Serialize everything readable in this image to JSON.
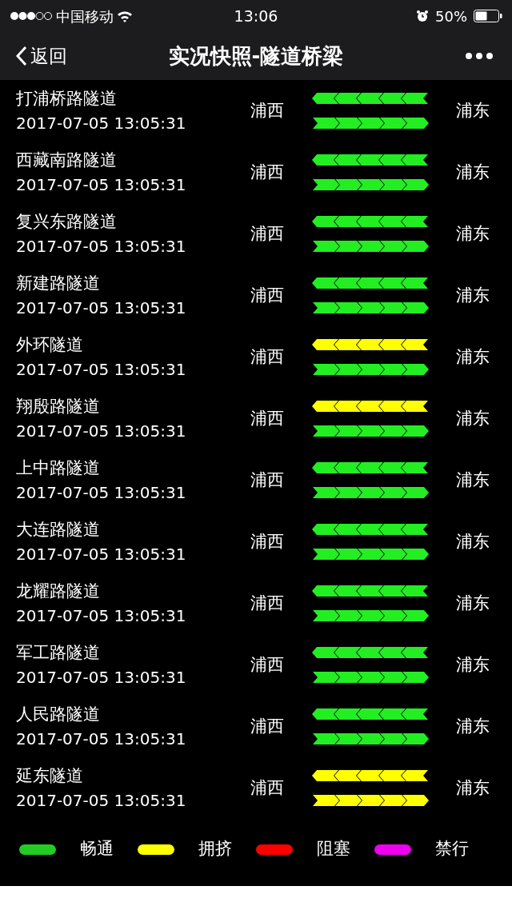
{
  "status_bar": {
    "carrier": "中国移动",
    "time": "13:06",
    "battery": "50%"
  },
  "nav": {
    "back": "返回",
    "title": "实况快照-隧道桥梁"
  },
  "tunnels": [
    {
      "name": "打浦桥路隧道",
      "time": "2017-07-05 13:05:31",
      "west": "浦西",
      "east": "浦东",
      "lanes": [
        {
          "kind": "westbound",
          "color": "#22ee22"
        },
        {
          "kind": "eastbound",
          "color": "#22ee22"
        }
      ]
    },
    {
      "name": "西藏南路隧道",
      "time": "2017-07-05 13:05:31",
      "west": "浦西",
      "east": "浦东",
      "lanes": [
        {
          "kind": "westbound",
          "color": "#22ee22"
        },
        {
          "kind": "eastbound",
          "color": "#22ee22"
        }
      ]
    },
    {
      "name": "复兴东路隧道",
      "time": "2017-07-05 13:05:31",
      "west": "浦西",
      "east": "浦东",
      "lanes": [
        {
          "kind": "westbound",
          "color": "#22ee22"
        },
        {
          "kind": "eastbound",
          "color": "#22ee22"
        }
      ]
    },
    {
      "name": "新建路隧道",
      "time": "2017-07-05 13:05:31",
      "west": "浦西",
      "east": "浦东",
      "lanes": [
        {
          "kind": "westbound",
          "color": "#22ee22"
        },
        {
          "kind": "eastbound",
          "color": "#22ee22"
        }
      ]
    },
    {
      "name": "外环隧道",
      "time": "2017-07-05 13:05:31",
      "west": "浦西",
      "east": "浦东",
      "lanes": [
        {
          "kind": "westbound",
          "color": "#ffff00"
        },
        {
          "kind": "eastbound",
          "color": "#22ee22"
        }
      ]
    },
    {
      "name": "翔殷路隧道",
      "time": "2017-07-05 13:05:31",
      "west": "浦西",
      "east": "浦东",
      "lanes": [
        {
          "kind": "westbound",
          "color": "#ffff00"
        },
        {
          "kind": "eastbound",
          "color": "#22ee22"
        }
      ]
    },
    {
      "name": "上中路隧道",
      "time": "2017-07-05 13:05:31",
      "west": "浦西",
      "east": "浦东",
      "lanes": [
        {
          "kind": "westbound",
          "color": "#22ee22"
        },
        {
          "kind": "eastbound",
          "color": "#22ee22"
        }
      ]
    },
    {
      "name": "大连路隧道",
      "time": "2017-07-05 13:05:31",
      "west": "浦西",
      "east": "浦东",
      "lanes": [
        {
          "kind": "westbound",
          "color": "#22ee22"
        },
        {
          "kind": "eastbound",
          "color": "#22ee22"
        }
      ]
    },
    {
      "name": "龙耀路隧道",
      "time": "2017-07-05 13:05:31",
      "west": "浦西",
      "east": "浦东",
      "lanes": [
        {
          "kind": "westbound",
          "color": "#22ee22"
        },
        {
          "kind": "eastbound",
          "color": "#22ee22"
        }
      ]
    },
    {
      "name": "军工路隧道",
      "time": "2017-07-05 13:05:31",
      "west": "浦西",
      "east": "浦东",
      "lanes": [
        {
          "kind": "westbound",
          "color": "#22ee22"
        },
        {
          "kind": "eastbound",
          "color": "#22ee22"
        }
      ]
    },
    {
      "name": "人民路隧道",
      "time": "2017-07-05 13:05:31",
      "west": "浦西",
      "east": "浦东",
      "lanes": [
        {
          "kind": "westbound",
          "color": "#22ee22"
        },
        {
          "kind": "eastbound",
          "color": "#22ee22"
        }
      ]
    },
    {
      "name": "延东隧道",
      "time": "2017-07-05 13:05:31",
      "west": "浦西",
      "east": "浦东",
      "lanes": [
        {
          "kind": "westbound",
          "color": "#ffff00"
        },
        {
          "kind": "eastbound",
          "color": "#ffff00"
        }
      ]
    }
  ],
  "legend": [
    {
      "label": "畅通",
      "color": "#22cc22"
    },
    {
      "label": "拥挤",
      "color": "#ffff00"
    },
    {
      "label": "阻塞",
      "color": "#ff0000"
    },
    {
      "label": "禁行",
      "color": "#ee00ee"
    }
  ]
}
